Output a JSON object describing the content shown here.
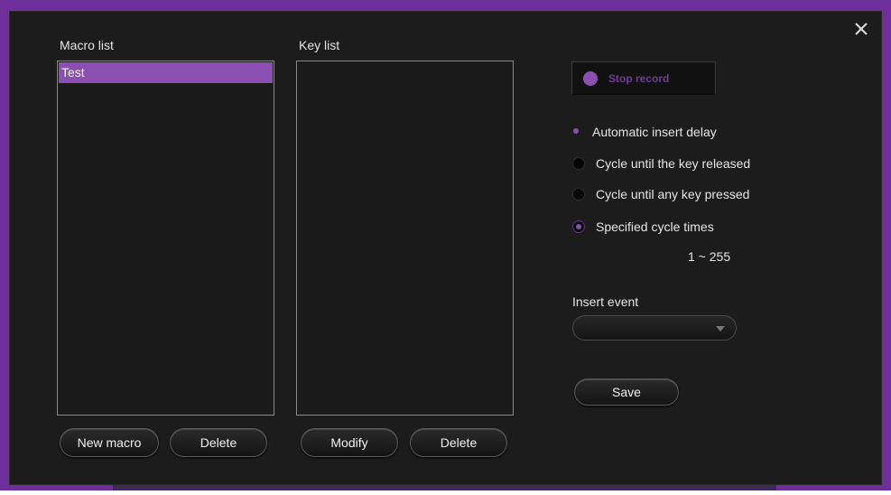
{
  "macro_panel": {
    "title": "Macro list",
    "items": [
      {
        "label": "Test",
        "selected": true
      }
    ],
    "new_button": "New macro",
    "delete_button": "Delete"
  },
  "key_panel": {
    "title": "Key list",
    "items": [],
    "modify_button": "Modify",
    "delete_button": "Delete"
  },
  "record": {
    "label": "Stop record"
  },
  "options": {
    "auto_delay": {
      "label": "Automatic insert delay",
      "selected": true
    },
    "cycle_modes": [
      {
        "label": "Cycle until the key released",
        "selected": false
      },
      {
        "label": "Cycle until any key pressed",
        "selected": false
      },
      {
        "label": "Specified cycle times",
        "selected": true
      }
    ],
    "range": "1 ~ 255"
  },
  "insert_event": {
    "title": "Insert event",
    "value": ""
  },
  "save_button": "Save",
  "colors": {
    "accent": "#8a4fb0",
    "frame": "#6e2f9a",
    "background": "#1c1c1c"
  },
  "icons": {
    "close": "close-icon",
    "record": "record-dot-icon",
    "dropdown": "chevron-down-icon"
  }
}
